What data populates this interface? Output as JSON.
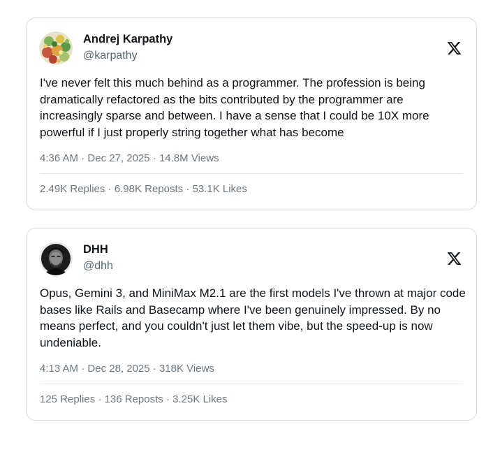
{
  "tweets": [
    {
      "author": {
        "name": "Andrej Karpathy",
        "handle": "@karpathy"
      },
      "text": "I've never felt this much behind as a programmer. The profession is being dramatically refactored as the bits contributed by the programmer are increasingly sparse and between. I have a sense that I could be 10X more powerful if I just properly string together what has become",
      "time": "4:36 AM",
      "date": "Dec 27, 2025",
      "views": "14.8M Views",
      "replies": "2.49K Replies",
      "reposts": "6.98K Reposts",
      "likes": "53.1K Likes",
      "separator": " · "
    },
    {
      "author": {
        "name": "DHH",
        "handle": "@dhh"
      },
      "text": "Opus, Gemini 3, and MiniMax M2.1 are the first models I've thrown at major code bases like Rails and Basecamp where I've been genuinely impressed. By no means perfect, and you couldn't just let them vibe, but the speed-up is now undeniable.",
      "time": "4:13 AM",
      "date": "Dec 28, 2025",
      "views": "318K Views",
      "replies": "125 Replies",
      "reposts": "136 Reposts",
      "likes": "3.25K Likes",
      "separator": " · "
    }
  ],
  "icons": {
    "brand": "x-logo-icon"
  },
  "colors": {
    "text": "#0f1419",
    "secondary": "#536471",
    "border": "#d9dde1"
  }
}
